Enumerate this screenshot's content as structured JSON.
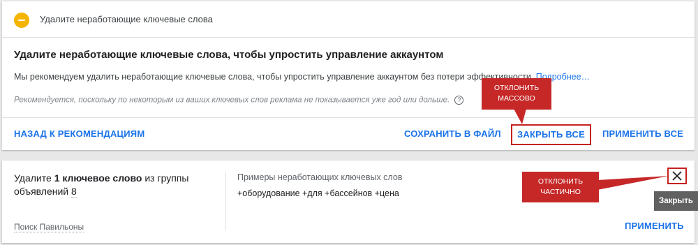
{
  "card1": {
    "header_title": "Удалите неработающие ключевые слова",
    "main_title": "Удалите неработающие ключевые слова, чтобы упростить управление аккаунтом",
    "description": "Мы рекомендуем удалить неработающие ключевые слова, чтобы упростить управление аккаунтом без потери эффективности.",
    "more_link": "Подробнее…",
    "note": "Рекомендуется, поскольку по некоторым из ваших ключевых слов реклама не показывается уже год или дольше.",
    "help_glyph": "?",
    "actions": {
      "back": "НАЗАД К РЕКОМЕНДАЦИЯМ",
      "save": "СОХРАНИТЬ В ФАЙЛ",
      "close_all": "ЗАКРЫТЬ ВСЕ",
      "apply_all": "ПРИМЕНИТЬ ВСЕ"
    }
  },
  "callouts": {
    "bulk": [
      "ОТКЛОНИТЬ",
      "МАССОВО"
    ],
    "partial": [
      "ОТКЛОНИТЬ",
      "ЧАСТИЧНО"
    ]
  },
  "card2": {
    "title_prefix": "Удалите ",
    "title_bold": "1 ключевое слово",
    "title_middle": " из группы объявлений ",
    "title_count": "8",
    "campaign": "Поиск Павильоны",
    "examples_label": "Примеры неработающих ключевых слов",
    "examples_value": "+оборудование +для +бассейнов +цена",
    "apply": "ПРИМЕНИТЬ",
    "tooltip": "Закрыть"
  },
  "colors": {
    "accent": "#1a73e8",
    "warning_icon": "#f4b400",
    "callout": "#c62828"
  }
}
